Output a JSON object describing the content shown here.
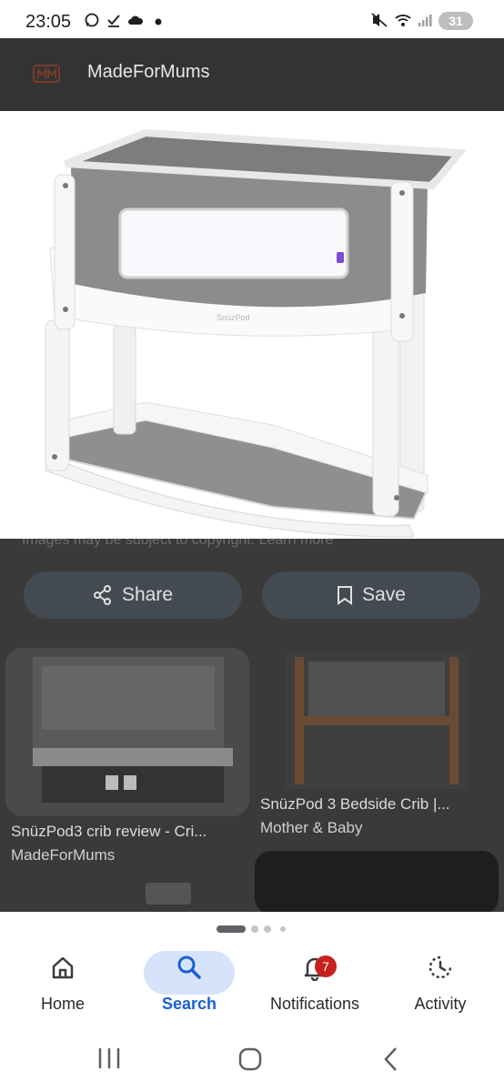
{
  "status_bar": {
    "time": "23:05",
    "battery": "31"
  },
  "header": {
    "site_name": "MadeForMums"
  },
  "image_panel": {
    "brand_text": "SnüzPod"
  },
  "copyright_text": "Images may be subject to copyright. Learn more",
  "actions": {
    "share_label": "Share",
    "save_label": "Save"
  },
  "results": [
    {
      "title": "SnüzPod3 crib review - Cri...",
      "source": "MadeForMums"
    },
    {
      "title": "SnüzPod 3 Bedside Crib |...",
      "source": "Mother & Baby"
    }
  ],
  "bottom_nav": {
    "home": "Home",
    "search": "Search",
    "notifications": "Notifications",
    "notifications_badge": "7",
    "activity": "Activity"
  },
  "colors": {
    "accent": "#1a5fd0",
    "nav_pill": "#d6e4fb",
    "badge": "#c5221f"
  }
}
